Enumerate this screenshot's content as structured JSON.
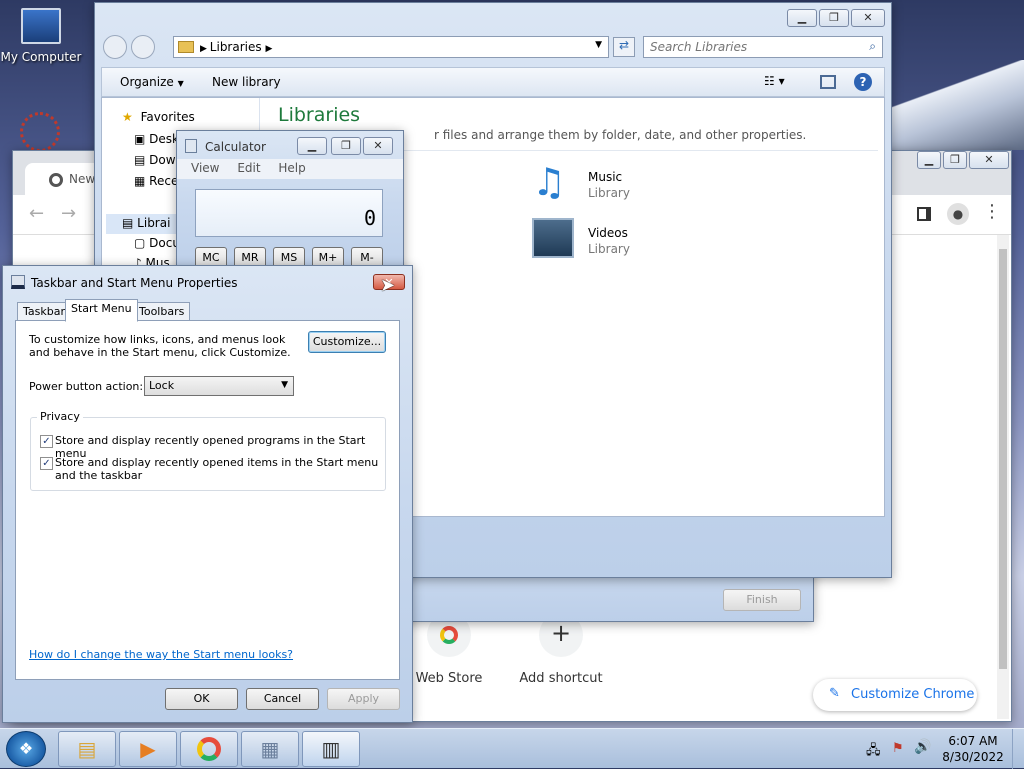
{
  "desktop": {
    "icons": [
      {
        "label": "My Computer",
        "icon": "computer-icon"
      }
    ]
  },
  "chrome": {
    "tab_label": "New Ta",
    "shortcuts": [
      {
        "label": "Web Store"
      },
      {
        "label": "Add shortcut"
      }
    ],
    "customize_label": "Customize Chrome"
  },
  "explorer": {
    "breadcrumb": "Libraries",
    "search_placeholder": "Search Libraries",
    "organize_label": "Organize",
    "new_library_label": "New library",
    "nav": {
      "favorites": "Favorites",
      "desktop": "Desk",
      "downloads": "Dow",
      "recent": "Rece",
      "libraries": "Librai",
      "documents": "Docu",
      "music": "Mus"
    },
    "heading": "Libraries",
    "description": "Open a library to see your files and arrange them by folder, date, and other properties.",
    "description_visible": "r files and arrange them by folder, date, and other properties.",
    "libraries": [
      {
        "name": "Music",
        "type": "Library",
        "icon": "music-library-icon"
      },
      {
        "name": "Videos",
        "type": "Library",
        "icon": "videos-library-icon"
      }
    ],
    "finish_label": "Finish"
  },
  "calculator": {
    "title": "Calculator",
    "menu": [
      "View",
      "Edit",
      "Help"
    ],
    "display": "0",
    "memory_buttons": [
      "MC",
      "MR",
      "MS",
      "M+",
      "M-"
    ]
  },
  "taskbar_props": {
    "title": "Taskbar and Start Menu Properties",
    "tabs": [
      "Taskbar",
      "Start Menu",
      "Toolbars"
    ],
    "active_tab": "Start Menu",
    "customize_text": "To customize how links, icons, and menus look and behave in the Start menu, click Customize.",
    "customize_button": "Customize...",
    "power_label": "Power button action:",
    "power_value": "Lock",
    "privacy_label": "Privacy",
    "privacy_options": [
      {
        "label": "Store and display recently opened programs in the Start menu",
        "checked": true
      },
      {
        "label": "Store and display recently opened items in the Start menu and the taskbar",
        "checked": true
      }
    ],
    "help_link": "How do I change the way the Start menu looks?",
    "ok": "OK",
    "cancel": "Cancel",
    "apply": "Apply"
  },
  "taskbar": {
    "apps": [
      "explorer-icon",
      "media-player-icon",
      "chrome-icon",
      "calculator-icon",
      "taskbar-properties-icon"
    ],
    "time": "6:07 AM",
    "date": "8/30/2022"
  }
}
